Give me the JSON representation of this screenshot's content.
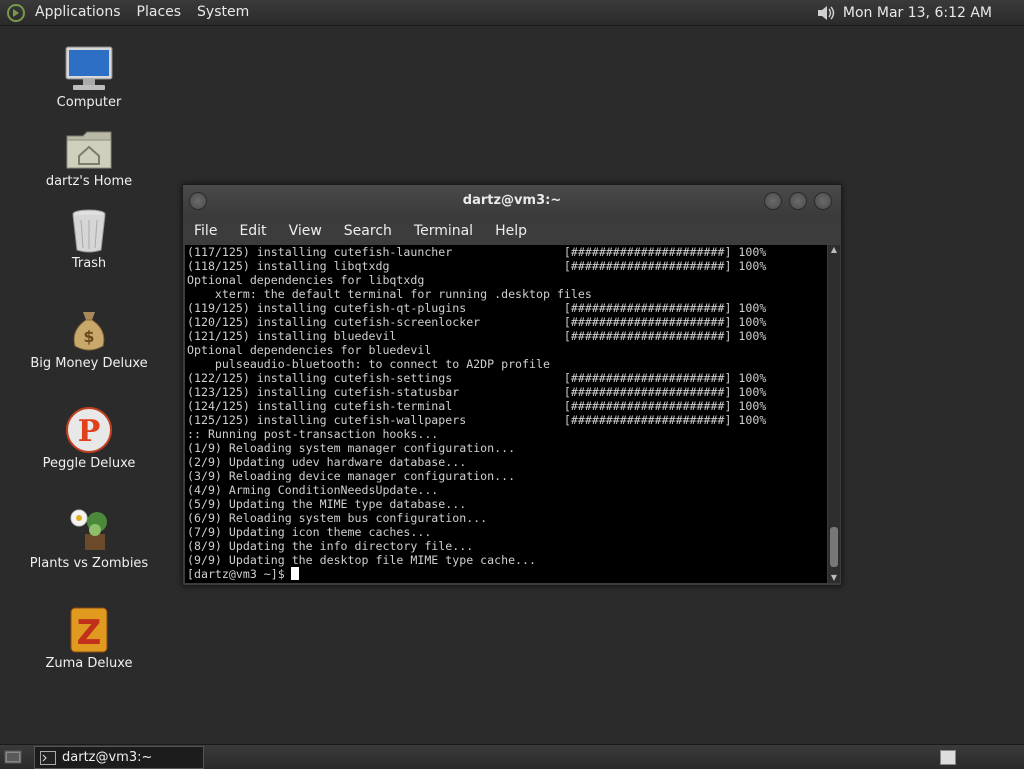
{
  "top_panel": {
    "menus": [
      "Applications",
      "Places",
      "System"
    ],
    "clock": "Mon Mar 13,  6:12 AM"
  },
  "desktop": {
    "icons": [
      {
        "label": "Computer",
        "icon": "computer-icon"
      },
      {
        "label": "dartz's Home",
        "icon": "home-folder-icon"
      },
      {
        "label": "Trash",
        "icon": "trash-icon"
      },
      {
        "label": "Big Money Deluxe",
        "icon": "money-bag-icon"
      },
      {
        "label": "Peggle Deluxe",
        "icon": "peggle-icon"
      },
      {
        "label": "Plants vs Zombies",
        "icon": "plants-vs-zombies-icon"
      },
      {
        "label": "Zuma Deluxe",
        "icon": "zuma-icon"
      }
    ]
  },
  "terminal": {
    "title": "dartz@vm3:~",
    "menus": [
      "File",
      "Edit",
      "View",
      "Search",
      "Terminal",
      "Help"
    ],
    "lines": [
      "(117/125) installing cutefish-launcher                [######################] 100%",
      "(118/125) installing libqtxdg                         [######################] 100%",
      "Optional dependencies for libqtxdg",
      "    xterm: the default terminal for running .desktop files",
      "(119/125) installing cutefish-qt-plugins              [######################] 100%",
      "(120/125) installing cutefish-screenlocker            [######################] 100%",
      "(121/125) installing bluedevil                        [######################] 100%",
      "Optional dependencies for bluedevil",
      "    pulseaudio-bluetooth: to connect to A2DP profile",
      "(122/125) installing cutefish-settings                [######################] 100%",
      "(123/125) installing cutefish-statusbar               [######################] 100%",
      "(124/125) installing cutefish-terminal                [######################] 100%",
      "(125/125) installing cutefish-wallpapers              [######################] 100%",
      ":: Running post-transaction hooks...",
      "(1/9) Reloading system manager configuration...",
      "(2/9) Updating udev hardware database...",
      "(3/9) Reloading device manager configuration...",
      "(4/9) Arming ConditionNeedsUpdate...",
      "(5/9) Updating the MIME type database...",
      "(6/9) Reloading system bus configuration...",
      "(7/9) Updating icon theme caches...",
      "(8/9) Updating the info directory file...",
      "(9/9) Updating the desktop file MIME type cache..."
    ],
    "prompt": "[dartz@vm3 ~]$"
  },
  "bottom_panel": {
    "task_label": "dartz@vm3:~"
  },
  "colors": {
    "desktop_bg": "#2b2b2b",
    "terminal_bg": "#000000",
    "terminal_fg": "#cfcfcf"
  }
}
